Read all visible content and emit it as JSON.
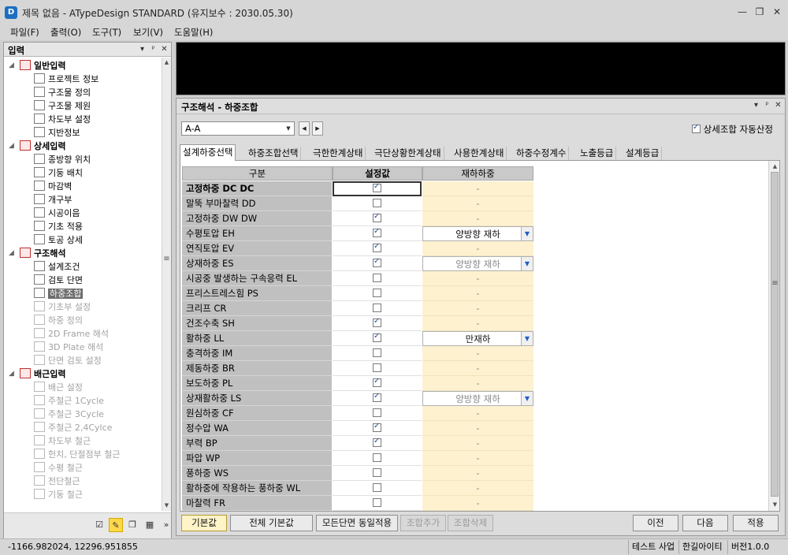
{
  "window": {
    "title": "제목 없음 - ATypeDesign STANDARD  (유지보수 : 2030.05.30)",
    "icon_label": "D",
    "controls": {
      "minimize": "—",
      "restore": "❐",
      "close": "✕"
    }
  },
  "menu": [
    "파일(F)",
    "출력(O)",
    "도구(T)",
    "보기(V)",
    "도움말(H)"
  ],
  "left_panel": {
    "title": "입력",
    "controls": {
      "pin_menu": "▾",
      "pin": "ᵖ",
      "close": "✕"
    },
    "tree": [
      {
        "label": "일반입력",
        "type": "group",
        "expander": "◢",
        "icon": "document-icon"
      },
      {
        "label": "프로젝트 정보",
        "type": "item",
        "icon": "project-info-icon"
      },
      {
        "label": "구조물 정의",
        "type": "item",
        "icon": "structure-define-icon"
      },
      {
        "label": "구조물 제원",
        "type": "item",
        "icon": "structure-spec-icon"
      },
      {
        "label": "차도부 설정",
        "type": "item",
        "icon": "roadway-icon"
      },
      {
        "label": "지반정보",
        "type": "item",
        "icon": "ground-info-icon"
      },
      {
        "label": "상세입력",
        "type": "group",
        "expander": "◢",
        "icon": "detail-input-icon"
      },
      {
        "label": "종방향 위치",
        "type": "item",
        "icon": "longitudinal-icon"
      },
      {
        "label": "기둥 배치",
        "type": "item",
        "icon": "column-layout-icon"
      },
      {
        "label": "마감벽",
        "type": "item",
        "icon": "finish-wall-icon"
      },
      {
        "label": "개구부",
        "type": "item",
        "icon": "opening-icon"
      },
      {
        "label": "시공이음",
        "type": "item",
        "icon": "joint-icon"
      },
      {
        "label": "기초 적용",
        "type": "item",
        "icon": "foundation-icon"
      },
      {
        "label": "토공 상세",
        "type": "item",
        "icon": "earthwork-icon"
      },
      {
        "label": "구조해석",
        "type": "group",
        "expander": "◢",
        "icon": "structural-analysis-icon"
      },
      {
        "label": "설계조건",
        "type": "item",
        "icon": "design-condition-icon"
      },
      {
        "label": "검토 단면",
        "type": "item",
        "icon": "review-section-icon"
      },
      {
        "label": "하중조합",
        "type": "item",
        "state": "selected",
        "icon": "load-combination-icon"
      },
      {
        "label": "기초부 설정",
        "type": "item",
        "state": "disabled",
        "icon": "foundation-setting-icon"
      },
      {
        "label": "하중 정의",
        "type": "item",
        "state": "disabled",
        "icon": "load-define-icon"
      },
      {
        "label": "2D Frame 해석",
        "type": "item",
        "state": "disabled",
        "icon": "frame-2d-icon"
      },
      {
        "label": "3D Plate 해석",
        "type": "item",
        "state": "disabled",
        "icon": "plate-3d-icon"
      },
      {
        "label": "단면 검토 설정",
        "type": "item",
        "state": "disabled",
        "icon": "section-check-icon"
      },
      {
        "label": "배근입력",
        "type": "group",
        "expander": "◢",
        "icon": "rebar-input-icon"
      },
      {
        "label": "배근 설정",
        "type": "item",
        "state": "disabled",
        "icon": "rebar-setting-icon"
      },
      {
        "label": "주철근 1Cycle",
        "type": "item",
        "state": "disabled",
        "icon": "main-rebar-icon"
      },
      {
        "label": "주철근 3Cycle",
        "type": "item",
        "state": "disabled",
        "icon": "main-rebar-icon"
      },
      {
        "label": "주철근 2,4Cylce",
        "type": "item",
        "state": "disabled",
        "icon": "main-rebar-icon"
      },
      {
        "label": "차도부 철근",
        "type": "item",
        "state": "disabled",
        "icon": "roadway-rebar-icon"
      },
      {
        "label": "헌치, 단절점부 철근",
        "type": "item",
        "state": "disabled",
        "icon": "haunch-rebar-icon"
      },
      {
        "label": "수평 철근",
        "type": "item",
        "state": "disabled",
        "icon": "horizontal-rebar-icon"
      },
      {
        "label": "전단철근",
        "type": "item",
        "state": "disabled",
        "icon": "shear-rebar-icon"
      },
      {
        "label": "기둥 철근",
        "type": "item",
        "state": "disabled",
        "icon": "column-rebar-icon"
      }
    ],
    "scroll": {
      "up": "▲",
      "down": "▼",
      "grip": "≡"
    },
    "toolbar": [
      {
        "name": "checkbox-tool-icon",
        "glyph": "☑"
      },
      {
        "name": "pencil-tool-icon",
        "glyph": "✎",
        "active": true
      },
      {
        "name": "copy-tool-icon",
        "glyph": "❐"
      },
      {
        "name": "excel-tool-icon",
        "glyph": "▦"
      },
      {
        "name": "more-tool-icon",
        "glyph": "»"
      }
    ]
  },
  "main_panel": {
    "title": "구조해석 - 하중조합",
    "controls": {
      "pin_menu": "▾",
      "pin": "ᵖ",
      "close": "✕"
    },
    "section_select": {
      "value": "A-A",
      "arrow": "▼",
      "prev": "◀",
      "next": "▶"
    },
    "auto_calc": {
      "label": "상세조합 자동산정",
      "checked": true
    },
    "tabs": [
      "설계하중선택",
      "하중조합선택",
      "극한한계상태",
      "극단상황한계상태",
      "사용한계상태",
      "하중수정계수",
      "노출등급",
      "설계등급"
    ],
    "active_tab": 0,
    "grid": {
      "headers": [
        "구분",
        "설정값",
        "재하하중"
      ],
      "rows": [
        {
          "name": "고정하중 DC DC",
          "checked": true,
          "load": "-",
          "bold": true,
          "focused": true
        },
        {
          "name": "말뚝 부마찰력 DD",
          "checked": false,
          "load": "-"
        },
        {
          "name": "고정하중 DW DW",
          "checked": true,
          "load": "-"
        },
        {
          "name": "수평토압 EH",
          "checked": true,
          "load": "양방향 재하",
          "dropdown": true
        },
        {
          "name": "연직토압 EV",
          "checked": true,
          "load": "-"
        },
        {
          "name": "상재하중 ES",
          "checked": true,
          "load": "양방향 재하",
          "dropdown": true,
          "disabled": true
        },
        {
          "name": "시공중 발생하는 구속응력 EL",
          "checked": false,
          "load": "-"
        },
        {
          "name": "프리스트레스힘 PS",
          "checked": false,
          "load": "-"
        },
        {
          "name": "크리프 CR",
          "checked": false,
          "load": "-"
        },
        {
          "name": "건조수축 SH",
          "checked": true,
          "load": "-"
        },
        {
          "name": "활하중 LL",
          "checked": true,
          "load": "만재하",
          "dropdown": true
        },
        {
          "name": "충격하중 IM",
          "checked": false,
          "load": "-"
        },
        {
          "name": "제동하중 BR",
          "checked": false,
          "load": "-"
        },
        {
          "name": "보도하중 PL",
          "checked": true,
          "load": "-"
        },
        {
          "name": "상재활하중 LS",
          "checked": true,
          "load": "양방향 재하",
          "dropdown": true,
          "disabled": true
        },
        {
          "name": "원심하중 CF",
          "checked": false,
          "load": "-"
        },
        {
          "name": "정수압 WA",
          "checked": true,
          "load": "-"
        },
        {
          "name": "부력 BP",
          "checked": true,
          "load": "-"
        },
        {
          "name": "파압 WP",
          "checked": false,
          "load": "-"
        },
        {
          "name": "풍하중 WS",
          "checked": false,
          "load": "-"
        },
        {
          "name": "활하중에 작용하는 풍하중 WL",
          "checked": false,
          "load": "-"
        },
        {
          "name": "마찰력 FR",
          "checked": false,
          "load": "-"
        }
      ],
      "scroll": {
        "up": "▲",
        "down": "▼",
        "grip": "≡"
      }
    },
    "buttons": {
      "default": "기본값",
      "all_default": "전체 기본값",
      "apply_all_sections": "모든단면 동일적용",
      "add_combination": "조합추가",
      "delete_combination": "조합삭제",
      "prev": "이전",
      "next": "다음",
      "apply": "적용"
    }
  },
  "status": {
    "coordinates": "-1166.982024,  12296.951855",
    "project": "테스트 사업",
    "company": "한길아이티",
    "version": "버전1.0.0"
  }
}
